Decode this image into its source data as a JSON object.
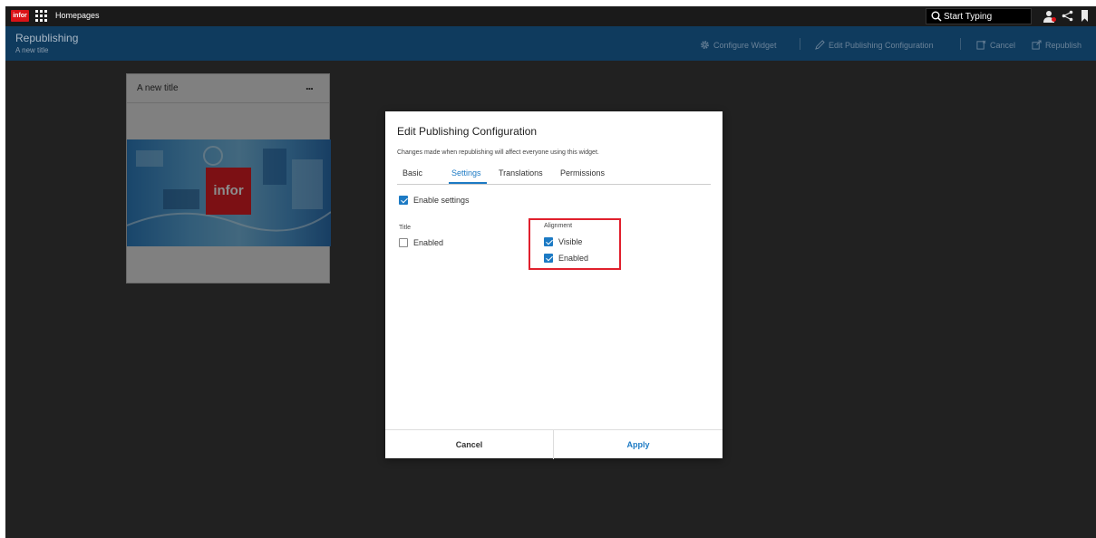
{
  "topbar": {
    "logo_text": "infor",
    "app_label": "Homepages",
    "search_placeholder": "Start Typing"
  },
  "header": {
    "title": "Republishing",
    "subtitle": "A new title",
    "configure_label": "Configure Widget",
    "edit_label": "Edit Publishing Configuration",
    "cancel_label": "Cancel",
    "republish_label": "Republish"
  },
  "widget": {
    "title": "A new title",
    "more_label": "...",
    "image_logo": "infor"
  },
  "dialog": {
    "title": "Edit Publishing Configuration",
    "note": "Changes made when republishing will affect everyone using this widget.",
    "tabs": [
      "Basic",
      "Settings",
      "Translations",
      "Permissions"
    ],
    "active_tab": "Settings",
    "enable_settings_label": "Enable settings",
    "enable_settings_checked": true,
    "title_section": {
      "label": "Title",
      "enabled_label": "Enabled",
      "enabled_checked": false
    },
    "alignment_section": {
      "label": "Alignment",
      "visible_label": "Visible",
      "visible_checked": true,
      "enabled_label": "Enabled",
      "enabled_checked": true
    },
    "cancel_button": "Cancel",
    "apply_button": "Apply"
  },
  "colors": {
    "accent": "#1c7ac4",
    "header_bg": "#0f3b5e",
    "brand_red": "#da1217",
    "highlight": "#e0202d"
  }
}
